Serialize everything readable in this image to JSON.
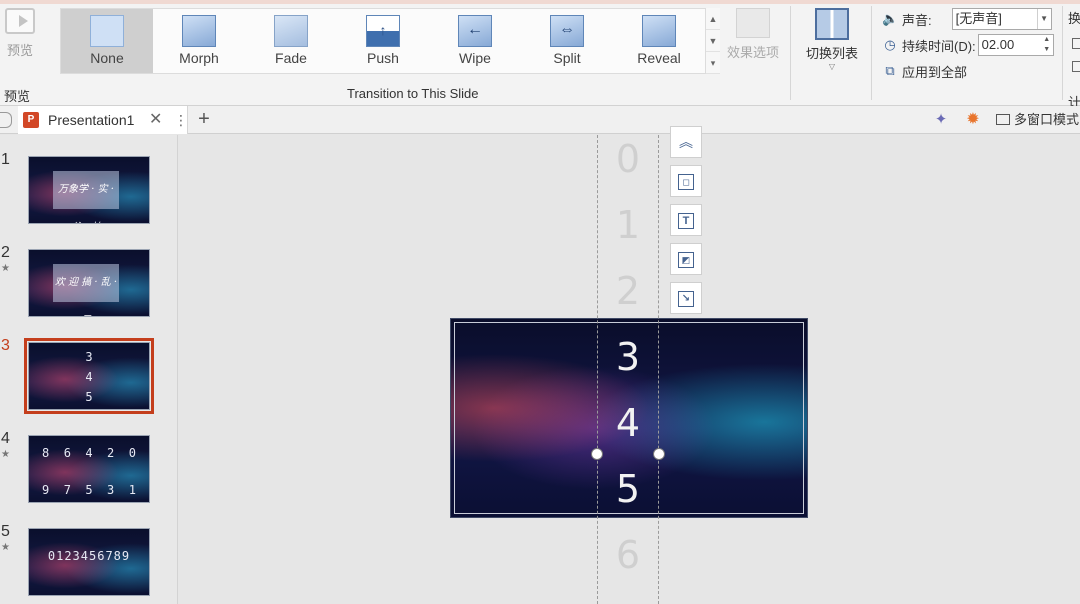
{
  "ribbon": {
    "preview_label": "预览",
    "preview_group": "预览",
    "transitions": [
      {
        "label": "None",
        "icon": "none-transition-icon"
      },
      {
        "label": "Morph",
        "icon": "morph-transition-icon"
      },
      {
        "label": "Fade",
        "icon": "fade-transition-icon"
      },
      {
        "label": "Push",
        "icon": "push-transition-icon"
      },
      {
        "label": "Wipe",
        "icon": "wipe-transition-icon"
      },
      {
        "label": "Split",
        "icon": "split-transition-icon"
      },
      {
        "label": "Reveal",
        "icon": "reveal-transition-icon"
      }
    ],
    "selected_transition": "None",
    "group_label": "Transition to This Slide",
    "effect_options": "效果选项",
    "switch_list": "切换列表",
    "sound_label": "声音:",
    "sound_value": "[无声音]",
    "duration_label": "持续时间(D):",
    "duration_value": "02.00",
    "apply_all": "应用到全部",
    "cut_label_1": "换",
    "cut_label_2": "计"
  },
  "tabbar": {
    "ppt_icon": "P",
    "doc_title": "Presentation1",
    "close": "✕",
    "more": "⋮",
    "new_tab": "+",
    "multiwindow": "多窗口模式"
  },
  "thumbnails": [
    {
      "num": "1",
      "star": "",
      "text": "万象学 · 实 · 谷 · 林"
    },
    {
      "num": "2",
      "star": "★",
      "text": "欢 迎 搞 · 乱 · 子"
    },
    {
      "num": "3",
      "star": "",
      "digits": "3\n4\n5"
    },
    {
      "num": "4",
      "star": "★",
      "digits_top": "8  6  4  2  0",
      "digits_bottom": "9  7  5  3  1"
    },
    {
      "num": "5",
      "star": "★",
      "digits": "0123456789"
    }
  ],
  "canvas": {
    "column_digits": [
      "0",
      "1",
      "2",
      "3",
      "4",
      "5",
      "6"
    ]
  },
  "colors": {
    "accent": "#c43e1c",
    "ribbon_bg": "#f3f3f3",
    "slide_bg": "#121748"
  }
}
